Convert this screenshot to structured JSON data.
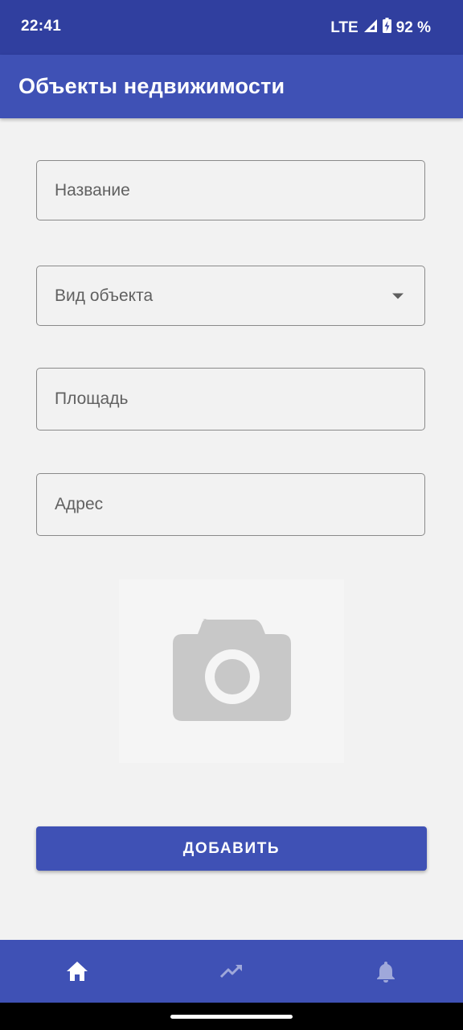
{
  "status_bar": {
    "time": "22:41",
    "network": "LTE",
    "battery": "92 %",
    "signal_icon": "signal-icon",
    "battery_icon": "battery-charging-icon"
  },
  "app_bar": {
    "title": "Объекты недвижимости"
  },
  "form": {
    "name_placeholder": "Название",
    "type_placeholder": "Вид объекта",
    "area_placeholder": "Площадь",
    "address_placeholder": "Адрес",
    "photo_icon": "camera-icon",
    "submit_label": "ДОБАВИТЬ"
  },
  "bottom_nav": {
    "items": [
      {
        "icon": "home-icon",
        "active": true
      },
      {
        "icon": "trending-up-icon",
        "active": false
      },
      {
        "icon": "bell-icon",
        "active": false
      }
    ]
  },
  "colors": {
    "status_bar": "#303f9f",
    "primary": "#3f51b5",
    "background": "#f2f2f2",
    "nav_active": "#ffffff",
    "nav_inactive": "#9fa8da"
  }
}
